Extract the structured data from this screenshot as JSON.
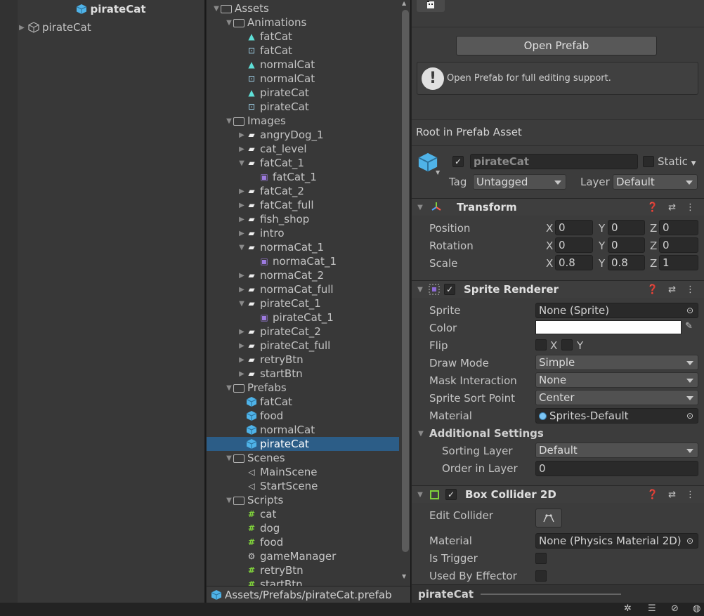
{
  "hierarchy": {
    "scene_title": "pirateCat",
    "root_item": "pirateCat"
  },
  "project": {
    "tree": [
      {
        "label": "Assets",
        "type": "folder",
        "depth": 0,
        "expanded": true
      },
      {
        "label": "Animations",
        "type": "folder",
        "depth": 1,
        "expanded": true
      },
      {
        "label": "fatCat",
        "type": "anim",
        "depth": 2
      },
      {
        "label": "fatCat",
        "type": "controller",
        "depth": 2
      },
      {
        "label": "normalCat",
        "type": "anim",
        "depth": 2
      },
      {
        "label": "normalCat",
        "type": "controller",
        "depth": 2
      },
      {
        "label": "pirateCat",
        "type": "anim",
        "depth": 2
      },
      {
        "label": "pirateCat",
        "type": "controller",
        "depth": 2
      },
      {
        "label": "Images",
        "type": "folder",
        "depth": 1,
        "expanded": true
      },
      {
        "label": "angryDog_1",
        "type": "image",
        "depth": 2,
        "collapsed": true
      },
      {
        "label": "cat_level",
        "type": "image",
        "depth": 2,
        "collapsed": true
      },
      {
        "label": "fatCat_1",
        "type": "image",
        "depth": 2,
        "expanded": true
      },
      {
        "label": "fatCat_1",
        "type": "sprite",
        "depth": 3
      },
      {
        "label": "fatCat_2",
        "type": "image",
        "depth": 2,
        "collapsed": true
      },
      {
        "label": "fatCat_full",
        "type": "image",
        "depth": 2,
        "collapsed": true
      },
      {
        "label": "fish_shop",
        "type": "image",
        "depth": 2,
        "collapsed": true
      },
      {
        "label": "intro",
        "type": "image",
        "depth": 2,
        "collapsed": true
      },
      {
        "label": "normaCat_1",
        "type": "image",
        "depth": 2,
        "expanded": true
      },
      {
        "label": "normaCat_1",
        "type": "sprite",
        "depth": 3
      },
      {
        "label": "normaCat_2",
        "type": "image",
        "depth": 2,
        "collapsed": true
      },
      {
        "label": "normaCat_full",
        "type": "image",
        "depth": 2,
        "collapsed": true
      },
      {
        "label": "pirateCat_1",
        "type": "image",
        "depth": 2,
        "expanded": true
      },
      {
        "label": "pirateCat_1",
        "type": "sprite",
        "depth": 3
      },
      {
        "label": "pirateCat_2",
        "type": "image",
        "depth": 2,
        "collapsed": true
      },
      {
        "label": "pirateCat_full",
        "type": "image",
        "depth": 2,
        "collapsed": true
      },
      {
        "label": "retryBtn",
        "type": "image",
        "depth": 2,
        "collapsed": true
      },
      {
        "label": "startBtn",
        "type": "image",
        "depth": 2,
        "collapsed": true
      },
      {
        "label": "Prefabs",
        "type": "folder",
        "depth": 1,
        "expanded": true
      },
      {
        "label": "fatCat",
        "type": "prefab",
        "depth": 2
      },
      {
        "label": "food",
        "type": "prefab",
        "depth": 2
      },
      {
        "label": "normalCat",
        "type": "prefab",
        "depth": 2
      },
      {
        "label": "pirateCat",
        "type": "prefab",
        "depth": 2,
        "selected": true
      },
      {
        "label": "Scenes",
        "type": "folder",
        "depth": 1,
        "expanded": true
      },
      {
        "label": "MainScene",
        "type": "scene",
        "depth": 2
      },
      {
        "label": "StartScene",
        "type": "scene",
        "depth": 2
      },
      {
        "label": "Scripts",
        "type": "folder",
        "depth": 1,
        "expanded": true
      },
      {
        "label": "cat",
        "type": "script",
        "depth": 2
      },
      {
        "label": "dog",
        "type": "script",
        "depth": 2
      },
      {
        "label": "food",
        "type": "script",
        "depth": 2
      },
      {
        "label": "gameManager",
        "type": "gear",
        "depth": 2
      },
      {
        "label": "retryBtn",
        "type": "script",
        "depth": 2
      },
      {
        "label": "startBtn",
        "type": "script",
        "depth": 2
      }
    ],
    "footer_path": "Assets/Prefabs/pirateCat.prefab"
  },
  "inspector": {
    "open_prefab_label": "Open Prefab",
    "info_message": "Open Prefab for full editing support.",
    "root_label": "Root in Prefab Asset",
    "object_name": "pirateCat",
    "static_label": "Static",
    "tag_label": "Tag",
    "tag_value": "Untagged",
    "layer_label": "Layer",
    "layer_value": "Default",
    "transform": {
      "title": "Transform",
      "rows": [
        {
          "label": "Position",
          "x": "0",
          "y": "0",
          "z": "0"
        },
        {
          "label": "Rotation",
          "x": "0",
          "y": "0",
          "z": "0"
        },
        {
          "label": "Scale",
          "x": "0.8",
          "y": "0.8",
          "z": "1"
        }
      ],
      "axis_x": "X",
      "axis_y": "Y",
      "axis_z": "Z"
    },
    "sprite_renderer": {
      "title": "Sprite Renderer",
      "sprite_label": "Sprite",
      "sprite_value": "None (Sprite)",
      "color_label": "Color",
      "flip_label": "Flip",
      "flip_x": "X",
      "flip_y": "Y",
      "draw_mode_label": "Draw Mode",
      "draw_mode_value": "Simple",
      "mask_label": "Mask Interaction",
      "mask_value": "None",
      "sort_point_label": "Sprite Sort Point",
      "sort_point_value": "Center",
      "material_label": "Material",
      "material_value": "Sprites-Default",
      "additional_label": "Additional Settings",
      "sorting_layer_label": "Sorting Layer",
      "sorting_layer_value": "Default",
      "order_label": "Order in Layer",
      "order_value": "0"
    },
    "box_collider": {
      "title": "Box Collider 2D",
      "edit_label": "Edit Collider",
      "material_label": "Material",
      "material_value": "None (Physics Material 2D)",
      "trigger_label": "Is Trigger",
      "effector_label": "Used By Effector"
    },
    "preview_label": "pirateCat"
  },
  "colors": {
    "selection": "#2c5d87",
    "prefab_blue": "#4fb3e8",
    "anim_cyan": "#5fe0d8",
    "collider_green": "#7fd13b"
  }
}
